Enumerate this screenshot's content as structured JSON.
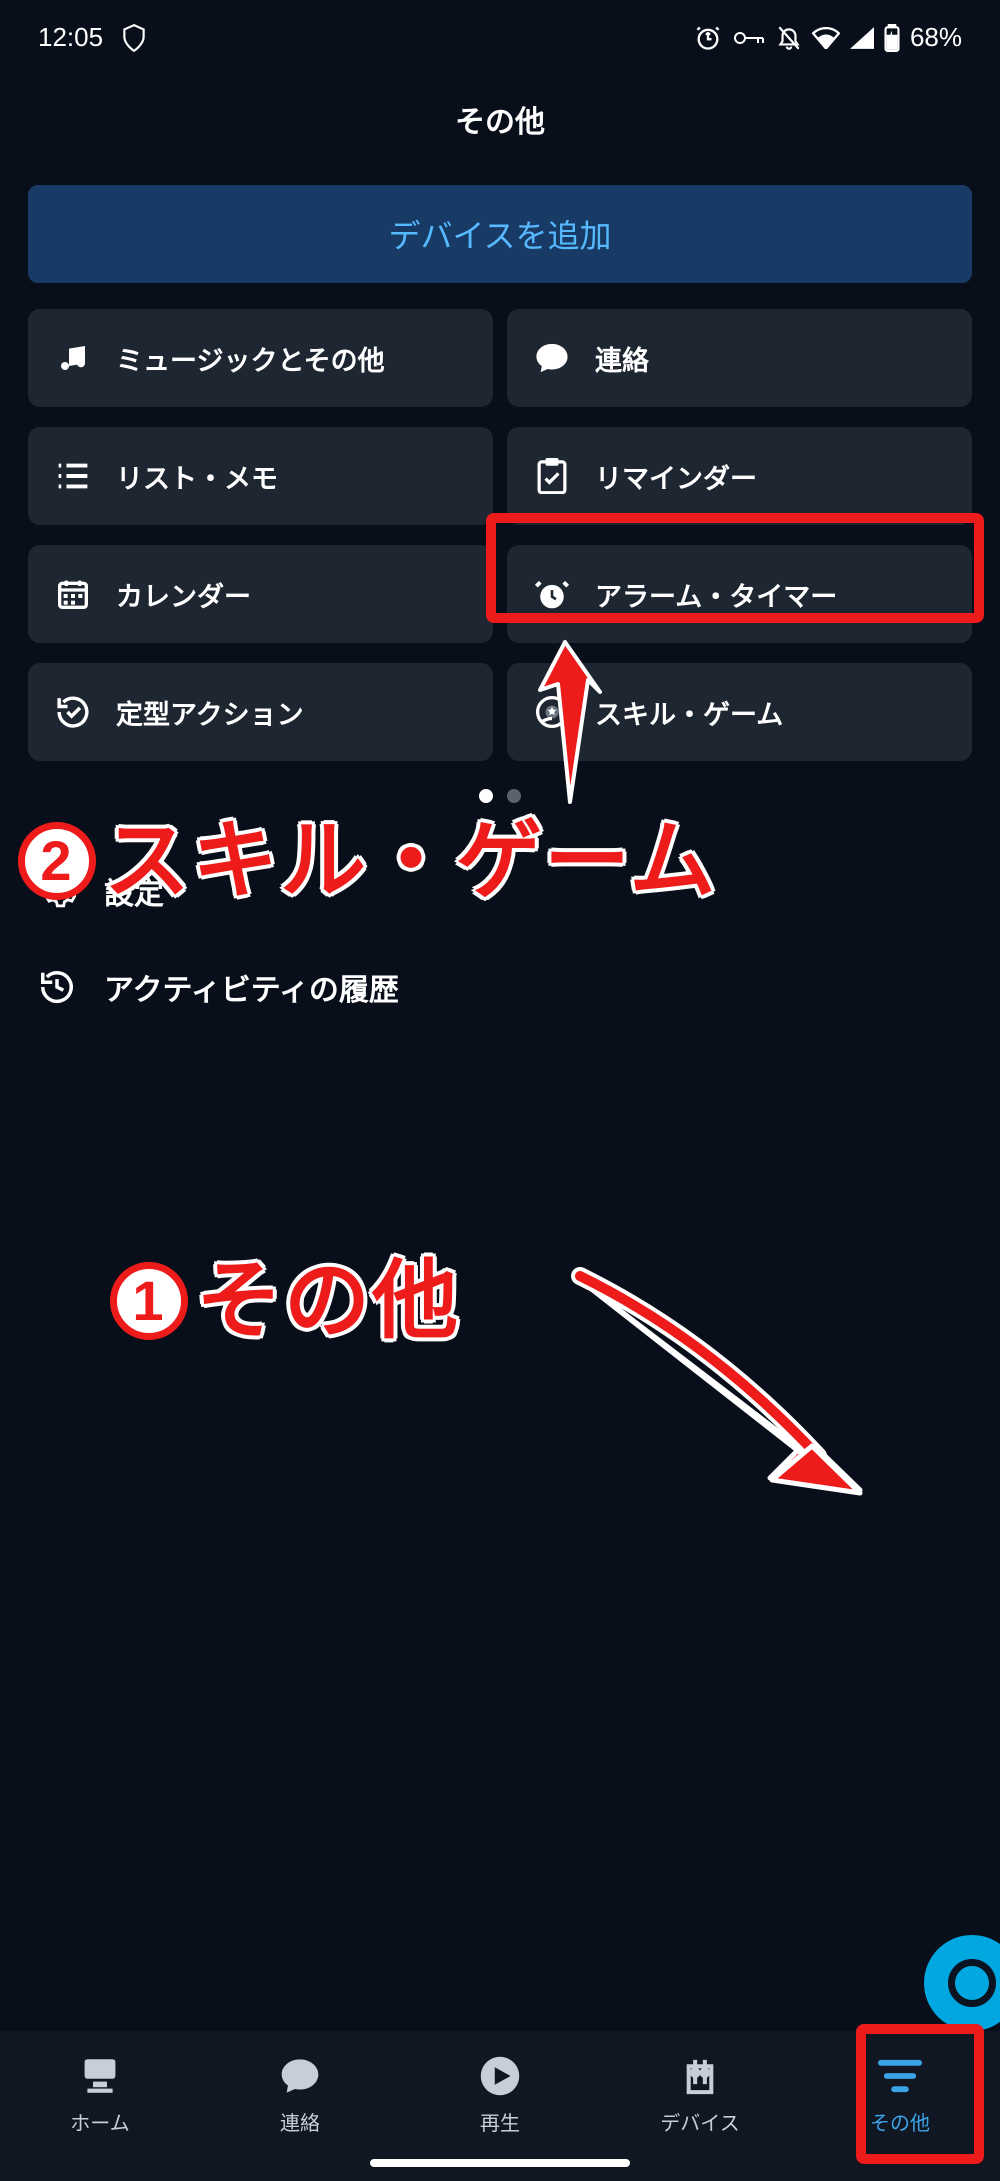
{
  "status": {
    "time": "12:05",
    "battery": "68%"
  },
  "page_title": "その他",
  "add_device_label": "デバイスを追加",
  "cards": [
    {
      "label": "ミュージックとその他"
    },
    {
      "label": "連絡"
    },
    {
      "label": "リスト・メモ"
    },
    {
      "label": "リマインダー"
    },
    {
      "label": "カレンダー"
    },
    {
      "label": "アラーム・タイマー"
    },
    {
      "label": "定型アクション"
    },
    {
      "label": "スキル・ゲーム"
    }
  ],
  "list_rows": [
    {
      "label": "設定"
    },
    {
      "label": "アクティビティの履歴"
    }
  ],
  "annotations": {
    "step1_num": "1",
    "step1_text": "その他",
    "step2_num": "2",
    "step2_text": "スキル・ゲーム"
  },
  "nav": [
    {
      "label": "ホーム"
    },
    {
      "label": "連絡"
    },
    {
      "label": "再生"
    },
    {
      "label": "デバイス"
    },
    {
      "label": "その他"
    }
  ]
}
